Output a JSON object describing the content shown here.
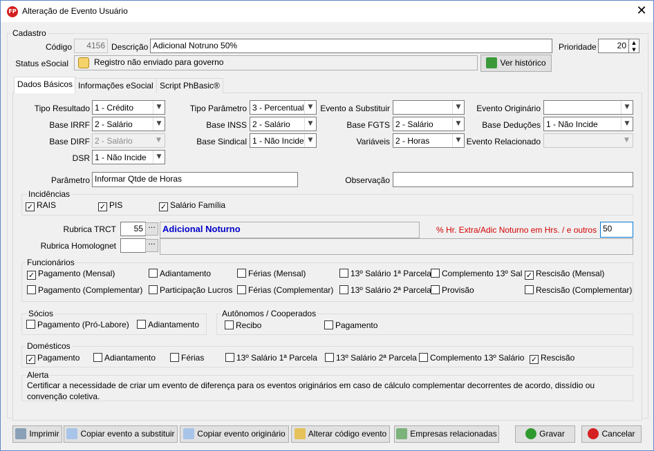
{
  "window": {
    "title": "Alteração de Evento Usuário",
    "app_icon_text": "FP"
  },
  "cadastro": {
    "group_title": "Cadastro",
    "codigo_label": "Código",
    "codigo_value": "4156",
    "descricao_label": "Descrição",
    "descricao_value": "Adicional Notruno 50%",
    "prioridade_label": "Prioridade",
    "prioridade_value": "20",
    "status_label": "Status eSocial",
    "status_value": "Registro não enviado para governo",
    "historico_button": "Ver histórico"
  },
  "tabs": [
    "Dados Básicos",
    "Informações eSocial",
    "Script PhBasic®"
  ],
  "dados": {
    "tipo_resultado_label": "Tipo Resultado",
    "tipo_resultado_value": "1 - Crédito",
    "base_irrf_label": "Base IRRF",
    "base_irrf_value": "2 - Salário",
    "base_dirf_label": "Base DIRF",
    "base_dirf_value": "2 - Salário",
    "dsr_label": "DSR",
    "dsr_value": "1 - Não Incide",
    "tipo_parametro_label": "Tipo Parâmetro",
    "tipo_parametro_value": "3 - Percentual",
    "base_inss_label": "Base INSS",
    "base_inss_value": "2 - Salário",
    "base_sindical_label": "Base Sindical",
    "base_sindical_value": "1 - Não Incide",
    "evento_substituir_label": "Evento a Substituir",
    "evento_substituir_value": "",
    "base_fgts_label": "Base FGTS",
    "base_fgts_value": "2 - Salário",
    "variaveis_label": "Variáveis",
    "variaveis_value": "2 - Horas",
    "evento_originario_label": "Evento Originário",
    "evento_originario_value": "",
    "base_deducoes_label": "Base Deduções",
    "base_deducoes_value": "1 - Não Incide",
    "evento_relacionado_label": "Evento Relacionado",
    "evento_relacionado_value": "",
    "parametro_label": "Parâmetro",
    "parametro_value": "Informar Qtde de Horas",
    "observacao_label": "Observação",
    "observacao_value": ""
  },
  "incidencias": {
    "title": "Incidências",
    "items": [
      {
        "label": "RAIS",
        "checked": true
      },
      {
        "label": "PIS",
        "checked": true
      },
      {
        "label": "Salário Família",
        "checked": true
      }
    ]
  },
  "rubrica": {
    "trct_label": "Rubrica TRCT",
    "trct_code": "55",
    "trct_desc": "Adicional Noturno",
    "homolog_label": "Rubrica Homolognet",
    "homolog_code": "",
    "homolog_desc": "",
    "percent_label": "% Hr. Extra/Adic Noturno em Hrs. / e outros",
    "percent_value": "50",
    "dots": "···"
  },
  "funcionarios": {
    "title": "Funcionários",
    "items": [
      {
        "label": "Pagamento (Mensal)",
        "checked": true
      },
      {
        "label": "Adiantamento",
        "checked": false
      },
      {
        "label": "Férias (Mensal)",
        "checked": false
      },
      {
        "label": "13º Salário 1ª Parcela",
        "checked": false
      },
      {
        "label": "Complemento 13º Sal",
        "checked": false
      },
      {
        "label": "Rescisão (Mensal)",
        "checked": true
      },
      {
        "label": "Pagamento (Complementar)",
        "checked": false
      },
      {
        "label": "Participação Lucros",
        "checked": false
      },
      {
        "label": "Férias (Complementar)",
        "checked": false
      },
      {
        "label": "13º Salário 2ª Parcela",
        "checked": false
      },
      {
        "label": "Provisão",
        "checked": false
      },
      {
        "label": "Rescisão (Complementar)",
        "checked": false
      }
    ]
  },
  "socios": {
    "title": "Sócios",
    "items": [
      {
        "label": "Pagamento (Pró-Labore)",
        "checked": false
      },
      {
        "label": "Adiantamento",
        "checked": false
      }
    ]
  },
  "autonomos": {
    "title": "Autônomos / Cooperados",
    "items": [
      {
        "label": "Recibo",
        "checked": false
      },
      {
        "label": "Pagamento",
        "checked": false
      }
    ]
  },
  "domesticos": {
    "title": "Domésticos",
    "items": [
      {
        "label": "Pagamento",
        "checked": true
      },
      {
        "label": "Adiantamento",
        "checked": false
      },
      {
        "label": "Férias",
        "checked": false
      },
      {
        "label": "13º Salário 1ª Parcela",
        "checked": false
      },
      {
        "label": "13º Salário 2ª Parcela",
        "checked": false
      },
      {
        "label": "Complemento 13º Salário",
        "checked": false
      },
      {
        "label": "Rescisão",
        "checked": true
      }
    ]
  },
  "alerta": {
    "title": "Alerta",
    "text": "Certificar a necessidade de criar um evento de diferença para os eventos originários em caso de cálculo complementar decorrentes de acordo, dissídio ou convenção coletiva."
  },
  "footer": {
    "imprimir": "Imprimir",
    "copiar_substituir": "Copiar evento a substituir",
    "copiar_originario": "Copiar evento originário",
    "alterar_codigo": "Alterar código evento",
    "empresas": "Empresas relacionadas",
    "gravar": "Gravar",
    "cancelar": "Cancelar"
  },
  "colors": {
    "accent_blue": "#0000c8",
    "warning_red": "#d40000",
    "check_green": "#2e9a2e",
    "cancel_red": "#d42020"
  },
  "icons": {
    "close": "✕",
    "arrow": "▼",
    "check": "✓",
    "spin_up": "▲",
    "spin_down": "▼"
  }
}
